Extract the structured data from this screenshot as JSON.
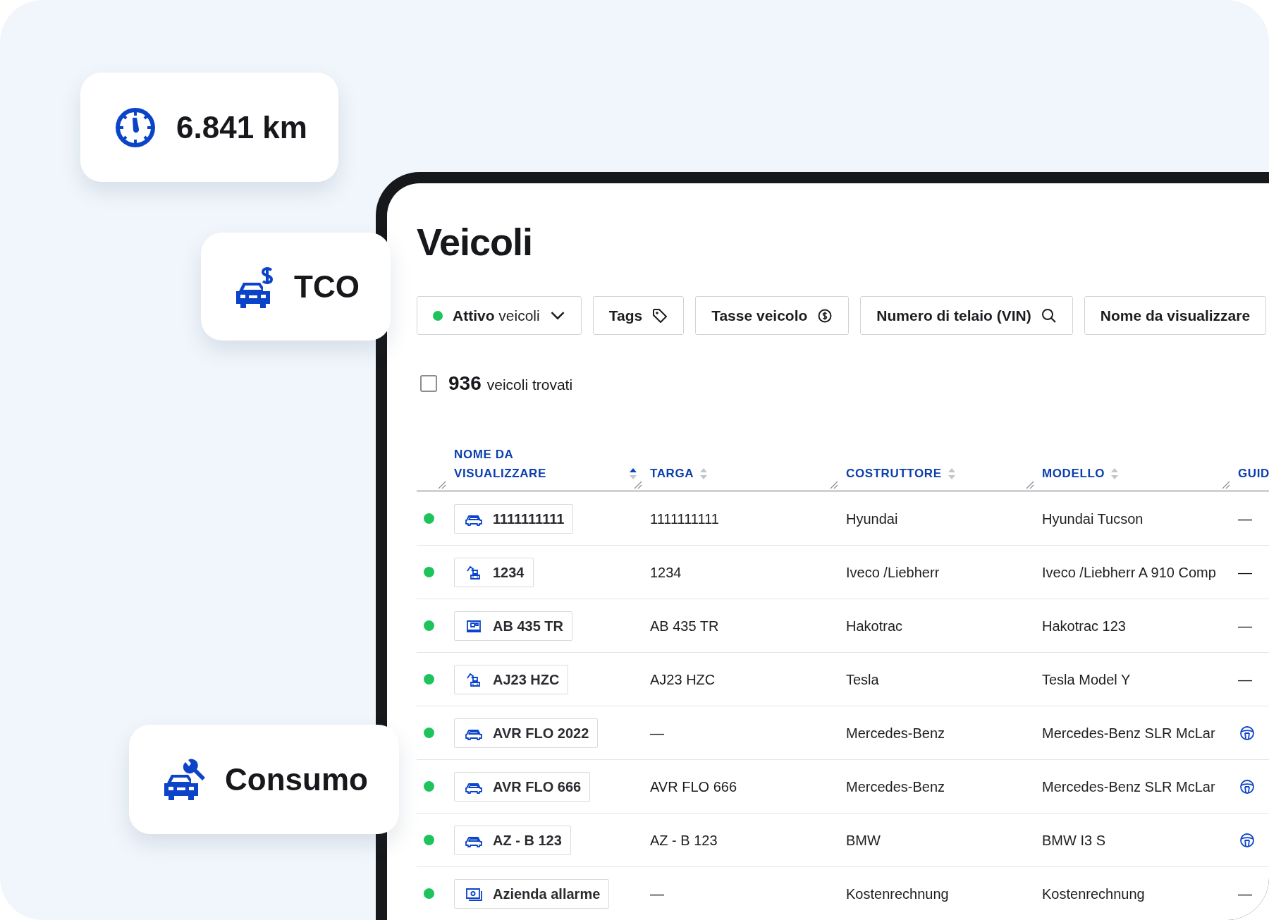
{
  "highlights": [
    {
      "kind": "gauge",
      "label": "6.841 km"
    },
    {
      "kind": "cost",
      "label": "TCO"
    },
    {
      "kind": "service",
      "label": "Consumo"
    }
  ],
  "page": {
    "title": "Veicoli"
  },
  "filters": [
    {
      "kind": "status",
      "label": "**Attivo** veicoli",
      "color": "#1ec45b"
    },
    {
      "kind": "tag",
      "label": "Tags"
    },
    {
      "kind": "tax",
      "label": "Tasse veicolo"
    },
    {
      "kind": "search",
      "label": "Numero di telaio (VIN)"
    },
    {
      "kind": "text",
      "label": "Nome da visualizzare"
    }
  ],
  "results": {
    "checked": false,
    "count": "936",
    "label": "veicoli trovati"
  },
  "table": {
    "columns": [
      {
        "label": "NOME DA VISUALIZZARE",
        "sorted": true
      },
      {
        "label": "TARGA",
        "sorted": false
      },
      {
        "label": "COSTRUTTORE",
        "sorted": false
      },
      {
        "label": "MODELLO",
        "sorted": false
      },
      {
        "label": "GUID"
      }
    ],
    "rows": [
      {
        "color": "#1ec45b",
        "kind": "car",
        "name": "1111111111",
        "plate": "1111111111",
        "maker": "Hyundai",
        "model": "Hyundai Tucson",
        "driver_assigned": false,
        "driver": "—"
      },
      {
        "color": "#1ec45b",
        "kind": "excavator",
        "name": "1234",
        "plate": "1234",
        "maker": "Iveco /Liebherr",
        "model": "Iveco /Liebherr A 910 Comp",
        "driver_assigned": false,
        "driver": "—"
      },
      {
        "color": "#1ec45b",
        "kind": "van",
        "name": "AB 435 TR",
        "plate": "AB 435 TR",
        "maker": "Hakotrac",
        "model": "Hakotrac 123",
        "driver_assigned": false,
        "driver": "—"
      },
      {
        "color": "#1ec45b",
        "kind": "excavator",
        "name": "AJ23 HZC",
        "plate": "AJ23 HZC",
        "maker": "Tesla",
        "model": "Tesla Model Y",
        "driver_assigned": false,
        "driver": "—"
      },
      {
        "color": "#1ec45b",
        "kind": "car",
        "name": "AVR FLO 2022",
        "plate": "—",
        "maker": "Mercedes-Benz",
        "model": "Mercedes-Benz SLR McLar",
        "driver_assigned": true
      },
      {
        "color": "#1ec45b",
        "kind": "car",
        "name": "AVR FLO 666",
        "plate": "AVR FLO 666",
        "maker": "Mercedes-Benz",
        "model": "Mercedes-Benz SLR McLar",
        "driver_assigned": true
      },
      {
        "color": "#1ec45b",
        "kind": "car",
        "name": "AZ - B 123",
        "plate": "AZ - B 123",
        "maker": "BMW",
        "model": "BMW I3 S",
        "driver_assigned": true
      },
      {
        "color": "#1ec45b",
        "kind": "device",
        "name": "Azienda allarme",
        "plate": "—",
        "maker": "Kostenrechnung",
        "model": "Kostenrechnung",
        "driver_assigned": false,
        "driver": "—"
      }
    ]
  }
}
